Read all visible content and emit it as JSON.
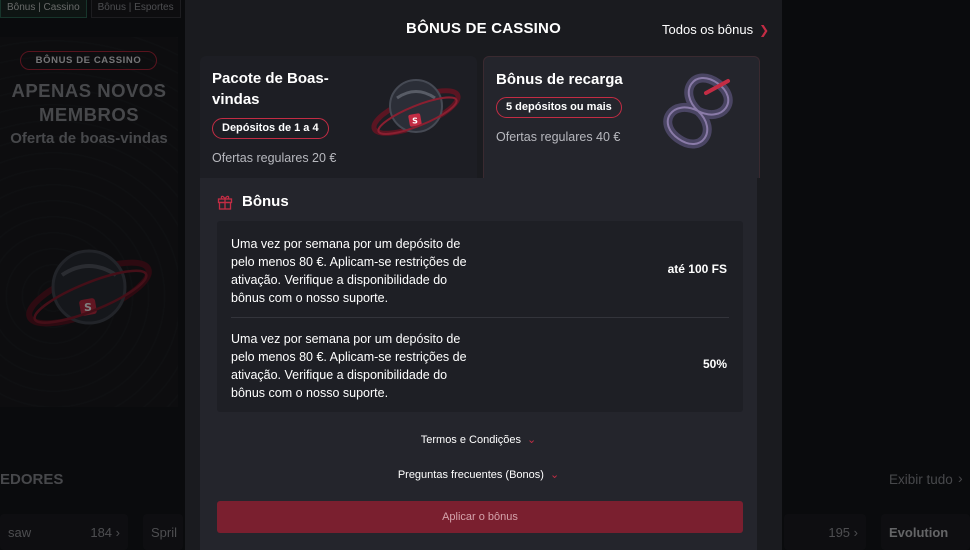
{
  "background": {
    "tabs": [
      {
        "label": "Bônus | Cassino"
      },
      {
        "label": "Bônus | Esportes"
      }
    ],
    "promo": {
      "badge": "BÔNUS DE CASSINO",
      "title": "APENAS NOVOS MEMBROS",
      "subtitle": "Oferta de boas-vindas"
    },
    "section_title": "EDORES",
    "see_all": "Exibir tudo",
    "cards": [
      {
        "label": "saw",
        "count": "184"
      },
      {
        "label": "Spril",
        "count": ""
      },
      {
        "label": "",
        "count": "195"
      },
      {
        "label": "Evolution",
        "count": ""
      }
    ]
  },
  "modal": {
    "title": "BÔNUS DE CASSINO",
    "all_bonuses": "Todos os bônus",
    "cards": [
      {
        "title": "Pacote de Boas-vindas",
        "pill": "Depósitos de 1 a 4",
        "offer": "Ofertas regulares 20 €",
        "image": "deposit-orb-image"
      },
      {
        "title": "Bônus de recarga",
        "pill": "5 depósitos ou mais",
        "offer": "Ofertas regulares 40 €",
        "image": "reload-infinity-image"
      }
    ],
    "section_title": "Bônus",
    "rows": [
      {
        "text": "Uma vez por semana por um depósito de pelo menos 80 €. Aplicam-se restrições de ativação. Verifique a disponibilidade do bônus com o nosso suporte.",
        "value": "até 100 FS"
      },
      {
        "text": "Uma vez por semana por um depósito de pelo menos 80 €. Aplicam-se restrições de ativação. Verifique a disponibilidade do bônus com o nosso suporte.",
        "value": "50%"
      }
    ],
    "terms": "Termos e Condições",
    "faq": "Preguntas frecuentes (Bonos)",
    "apply_button": "Aplicar o bônus"
  },
  "colors": {
    "accent": "#c32c44",
    "apply_bg": "#7a1f2f",
    "modal_bg": "#1a1b1f"
  },
  "icons": [
    "gift-icon",
    "chevron-right-icon",
    "chevron-down-icon"
  ]
}
